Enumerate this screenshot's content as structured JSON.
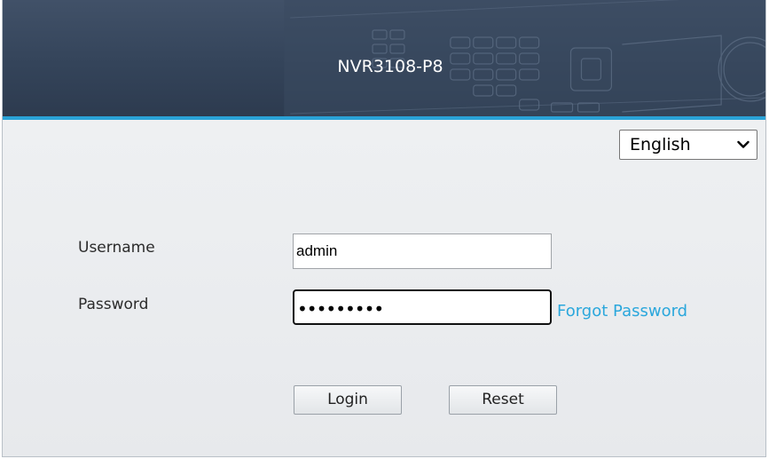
{
  "header": {
    "device_name": "NVR3108-P8"
  },
  "language": {
    "selected": "English"
  },
  "form": {
    "username_label": "Username",
    "password_label": "Password",
    "username_value": "admin",
    "password_masked": "•••••••••",
    "forgot_password_label": "Forgot Password"
  },
  "buttons": {
    "login_label": "Login",
    "reset_label": "Reset"
  },
  "colors": {
    "header_bg": "#34445a",
    "accent": "#2aa3d8",
    "link": "#2aa7dc"
  },
  "icons": {
    "language_dropdown": "chevron-down-icon"
  }
}
